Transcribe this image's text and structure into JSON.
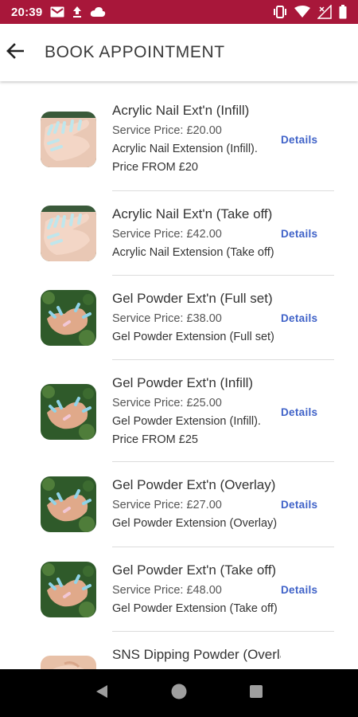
{
  "status_bar": {
    "time": "20:39",
    "left_icons": [
      "gmail-icon",
      "upload-icon",
      "cloud-icon"
    ],
    "right_icons": [
      "vibrate-icon",
      "wifi-icon",
      "signal-icon",
      "battery-icon"
    ],
    "color": "#a8173a"
  },
  "header": {
    "title": "BOOK APPOINTMENT",
    "back_icon": "arrow-left-icon"
  },
  "services": [
    {
      "name": "Acrylic Nail Ext'n (Infill)",
      "price": "Service Price: £20.00",
      "desc": "Acrylic Nail Extension (Infill).",
      "desc2": "Price FROM £20",
      "details": "Details",
      "image": "acrylic"
    },
    {
      "name": "Acrylic Nail Ext'n (Take off)",
      "price": "Service Price: £42.00",
      "desc": "Acrylic Nail Extension (Take off)",
      "desc2": "",
      "details": "Details",
      "image": "acrylic"
    },
    {
      "name": "Gel Powder Ext'n (Full set)",
      "price": "Service Price: £38.00",
      "desc": "Gel Powder Extension (Full set)",
      "desc2": "",
      "details": "Details",
      "image": "gel"
    },
    {
      "name": "Gel Powder Ext'n (Infill)",
      "price": "Service Price: £25.00",
      "desc": "Gel Powder Extension (Infill).",
      "desc2": "Price FROM £25",
      "details": "Details",
      "image": "gel"
    },
    {
      "name": "Gel Powder Ext'n (Overlay)",
      "price": "Service Price: £27.00",
      "desc": "Gel Powder Extension (Overlay)",
      "desc2": "",
      "details": "Details",
      "image": "gel"
    },
    {
      "name": "Gel Powder Ext'n (Take off)",
      "price": "Service Price: £48.00",
      "desc": "Gel Powder Extension (Take off)",
      "desc2": "",
      "details": "Details",
      "image": "gel"
    },
    {
      "name": "SNS Dipping Powder (Overlay)",
      "price": "",
      "desc": "",
      "desc2": "",
      "details": "",
      "image": "sns"
    }
  ],
  "colors": {
    "accent": "#a8173a",
    "link": "#3f62c8"
  },
  "nav_bar": {
    "icons": [
      "back-triangle-icon",
      "home-circle-icon",
      "recents-square-icon"
    ]
  }
}
